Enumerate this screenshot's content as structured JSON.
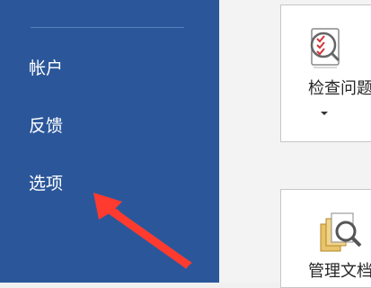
{
  "nav": {
    "account_label": "帐户",
    "feedback_label": "反馈",
    "options_label": "选项"
  },
  "tiles": {
    "inspect_label": "检查问题",
    "manage_label": "管理文档"
  },
  "colors": {
    "nav_background": "#2b579a",
    "annotation_arrow": "#ff3b30"
  },
  "icons": [
    "checklist-magnifier-icon",
    "chevron-down-icon",
    "documents-magnifier-icon",
    "annotation-arrow"
  ]
}
